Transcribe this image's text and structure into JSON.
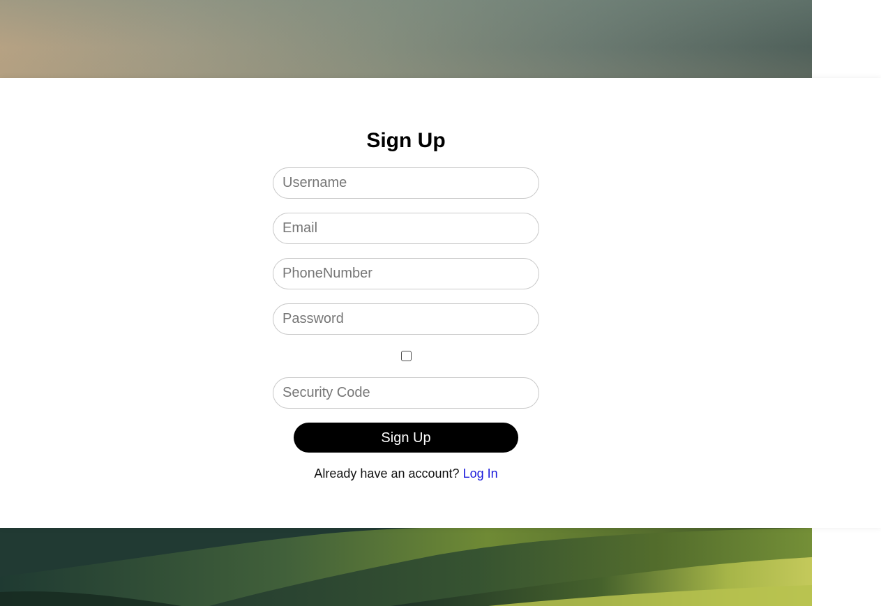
{
  "form": {
    "title": "Sign Up",
    "fields": {
      "username": {
        "placeholder": "Username",
        "value": ""
      },
      "email": {
        "placeholder": "Email",
        "value": ""
      },
      "phone": {
        "placeholder": "PhoneNumber",
        "value": ""
      },
      "password": {
        "placeholder": "Password",
        "value": ""
      },
      "security_code": {
        "placeholder": "Security Code",
        "value": ""
      }
    },
    "checkbox": {
      "checked": false
    },
    "submit_label": "Sign Up",
    "login_prompt": "Already have an account?",
    "login_link": "Log In"
  },
  "colors": {
    "button_bg": "#000000",
    "button_text": "#ffffff",
    "link": "#1a1adb",
    "input_border": "#c9c9c9"
  }
}
